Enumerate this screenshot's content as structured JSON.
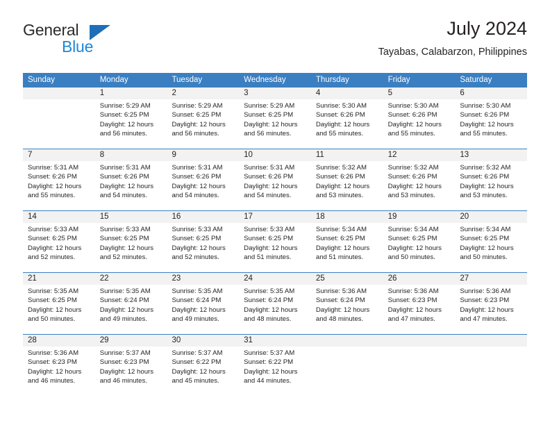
{
  "brand": {
    "name_top": "General",
    "name_bottom": "Blue",
    "triangle_color": "#1e6fb8",
    "blue_text_color": "#1e87d6"
  },
  "header": {
    "title": "July 2024",
    "subtitle": "Tayabas, Calabarzon, Philippines"
  },
  "theme": {
    "header_blue": "#3a7fc1",
    "daynum_band": "#f2f2f2",
    "text": "#231f20"
  },
  "weekdays": [
    "Sunday",
    "Monday",
    "Tuesday",
    "Wednesday",
    "Thursday",
    "Friday",
    "Saturday"
  ],
  "weeks": [
    {
      "days": [
        {
          "num": "",
          "sunrise": "",
          "sunset": "",
          "daylight": "",
          "daylight2": ""
        },
        {
          "num": "1",
          "sunrise": "Sunrise: 5:29 AM",
          "sunset": "Sunset: 6:25 PM",
          "daylight": "Daylight: 12 hours",
          "daylight2": "and 56 minutes."
        },
        {
          "num": "2",
          "sunrise": "Sunrise: 5:29 AM",
          "sunset": "Sunset: 6:25 PM",
          "daylight": "Daylight: 12 hours",
          "daylight2": "and 56 minutes."
        },
        {
          "num": "3",
          "sunrise": "Sunrise: 5:29 AM",
          "sunset": "Sunset: 6:25 PM",
          "daylight": "Daylight: 12 hours",
          "daylight2": "and 56 minutes."
        },
        {
          "num": "4",
          "sunrise": "Sunrise: 5:30 AM",
          "sunset": "Sunset: 6:26 PM",
          "daylight": "Daylight: 12 hours",
          "daylight2": "and 55 minutes."
        },
        {
          "num": "5",
          "sunrise": "Sunrise: 5:30 AM",
          "sunset": "Sunset: 6:26 PM",
          "daylight": "Daylight: 12 hours",
          "daylight2": "and 55 minutes."
        },
        {
          "num": "6",
          "sunrise": "Sunrise: 5:30 AM",
          "sunset": "Sunset: 6:26 PM",
          "daylight": "Daylight: 12 hours",
          "daylight2": "and 55 minutes."
        }
      ]
    },
    {
      "days": [
        {
          "num": "7",
          "sunrise": "Sunrise: 5:31 AM",
          "sunset": "Sunset: 6:26 PM",
          "daylight": "Daylight: 12 hours",
          "daylight2": "and 55 minutes."
        },
        {
          "num": "8",
          "sunrise": "Sunrise: 5:31 AM",
          "sunset": "Sunset: 6:26 PM",
          "daylight": "Daylight: 12 hours",
          "daylight2": "and 54 minutes."
        },
        {
          "num": "9",
          "sunrise": "Sunrise: 5:31 AM",
          "sunset": "Sunset: 6:26 PM",
          "daylight": "Daylight: 12 hours",
          "daylight2": "and 54 minutes."
        },
        {
          "num": "10",
          "sunrise": "Sunrise: 5:31 AM",
          "sunset": "Sunset: 6:26 PM",
          "daylight": "Daylight: 12 hours",
          "daylight2": "and 54 minutes."
        },
        {
          "num": "11",
          "sunrise": "Sunrise: 5:32 AM",
          "sunset": "Sunset: 6:26 PM",
          "daylight": "Daylight: 12 hours",
          "daylight2": "and 53 minutes."
        },
        {
          "num": "12",
          "sunrise": "Sunrise: 5:32 AM",
          "sunset": "Sunset: 6:26 PM",
          "daylight": "Daylight: 12 hours",
          "daylight2": "and 53 minutes."
        },
        {
          "num": "13",
          "sunrise": "Sunrise: 5:32 AM",
          "sunset": "Sunset: 6:26 PM",
          "daylight": "Daylight: 12 hours",
          "daylight2": "and 53 minutes."
        }
      ]
    },
    {
      "days": [
        {
          "num": "14",
          "sunrise": "Sunrise: 5:33 AM",
          "sunset": "Sunset: 6:25 PM",
          "daylight": "Daylight: 12 hours",
          "daylight2": "and 52 minutes."
        },
        {
          "num": "15",
          "sunrise": "Sunrise: 5:33 AM",
          "sunset": "Sunset: 6:25 PM",
          "daylight": "Daylight: 12 hours",
          "daylight2": "and 52 minutes."
        },
        {
          "num": "16",
          "sunrise": "Sunrise: 5:33 AM",
          "sunset": "Sunset: 6:25 PM",
          "daylight": "Daylight: 12 hours",
          "daylight2": "and 52 minutes."
        },
        {
          "num": "17",
          "sunrise": "Sunrise: 5:33 AM",
          "sunset": "Sunset: 6:25 PM",
          "daylight": "Daylight: 12 hours",
          "daylight2": "and 51 minutes."
        },
        {
          "num": "18",
          "sunrise": "Sunrise: 5:34 AM",
          "sunset": "Sunset: 6:25 PM",
          "daylight": "Daylight: 12 hours",
          "daylight2": "and 51 minutes."
        },
        {
          "num": "19",
          "sunrise": "Sunrise: 5:34 AM",
          "sunset": "Sunset: 6:25 PM",
          "daylight": "Daylight: 12 hours",
          "daylight2": "and 50 minutes."
        },
        {
          "num": "20",
          "sunrise": "Sunrise: 5:34 AM",
          "sunset": "Sunset: 6:25 PM",
          "daylight": "Daylight: 12 hours",
          "daylight2": "and 50 minutes."
        }
      ]
    },
    {
      "days": [
        {
          "num": "21",
          "sunrise": "Sunrise: 5:35 AM",
          "sunset": "Sunset: 6:25 PM",
          "daylight": "Daylight: 12 hours",
          "daylight2": "and 50 minutes."
        },
        {
          "num": "22",
          "sunrise": "Sunrise: 5:35 AM",
          "sunset": "Sunset: 6:24 PM",
          "daylight": "Daylight: 12 hours",
          "daylight2": "and 49 minutes."
        },
        {
          "num": "23",
          "sunrise": "Sunrise: 5:35 AM",
          "sunset": "Sunset: 6:24 PM",
          "daylight": "Daylight: 12 hours",
          "daylight2": "and 49 minutes."
        },
        {
          "num": "24",
          "sunrise": "Sunrise: 5:35 AM",
          "sunset": "Sunset: 6:24 PM",
          "daylight": "Daylight: 12 hours",
          "daylight2": "and 48 minutes."
        },
        {
          "num": "25",
          "sunrise": "Sunrise: 5:36 AM",
          "sunset": "Sunset: 6:24 PM",
          "daylight": "Daylight: 12 hours",
          "daylight2": "and 48 minutes."
        },
        {
          "num": "26",
          "sunrise": "Sunrise: 5:36 AM",
          "sunset": "Sunset: 6:23 PM",
          "daylight": "Daylight: 12 hours",
          "daylight2": "and 47 minutes."
        },
        {
          "num": "27",
          "sunrise": "Sunrise: 5:36 AM",
          "sunset": "Sunset: 6:23 PM",
          "daylight": "Daylight: 12 hours",
          "daylight2": "and 47 minutes."
        }
      ]
    },
    {
      "days": [
        {
          "num": "28",
          "sunrise": "Sunrise: 5:36 AM",
          "sunset": "Sunset: 6:23 PM",
          "daylight": "Daylight: 12 hours",
          "daylight2": "and 46 minutes."
        },
        {
          "num": "29",
          "sunrise": "Sunrise: 5:37 AM",
          "sunset": "Sunset: 6:23 PM",
          "daylight": "Daylight: 12 hours",
          "daylight2": "and 46 minutes."
        },
        {
          "num": "30",
          "sunrise": "Sunrise: 5:37 AM",
          "sunset": "Sunset: 6:22 PM",
          "daylight": "Daylight: 12 hours",
          "daylight2": "and 45 minutes."
        },
        {
          "num": "31",
          "sunrise": "Sunrise: 5:37 AM",
          "sunset": "Sunset: 6:22 PM",
          "daylight": "Daylight: 12 hours",
          "daylight2": "and 44 minutes."
        },
        {
          "num": "",
          "sunrise": "",
          "sunset": "",
          "daylight": "",
          "daylight2": ""
        },
        {
          "num": "",
          "sunrise": "",
          "sunset": "",
          "daylight": "",
          "daylight2": ""
        },
        {
          "num": "",
          "sunrise": "",
          "sunset": "",
          "daylight": "",
          "daylight2": ""
        }
      ]
    }
  ]
}
